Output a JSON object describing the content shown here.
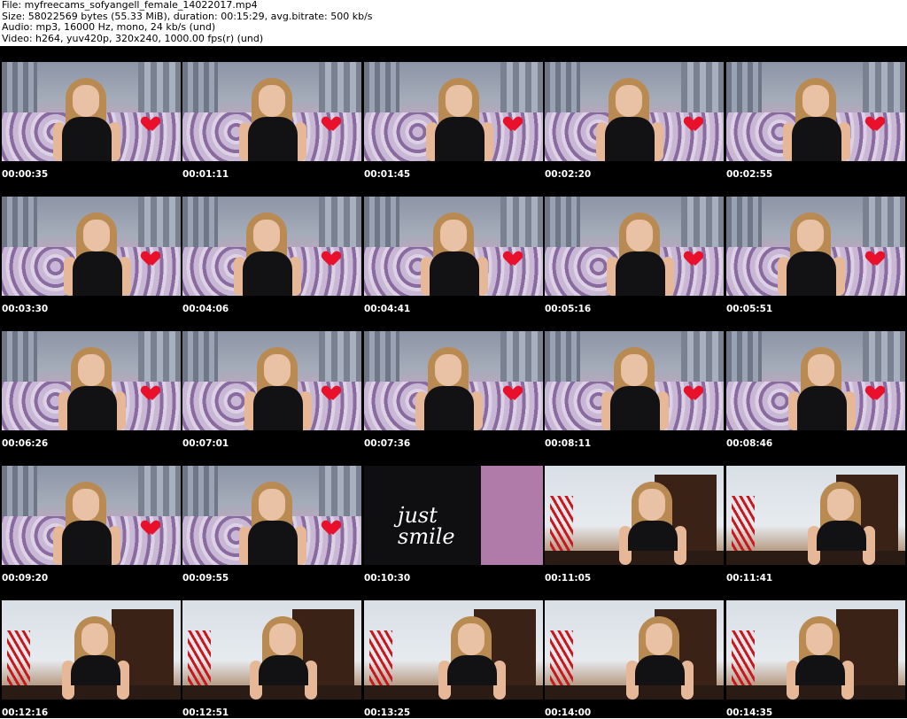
{
  "header": {
    "line1": "File: myfreecams_sofyangell_female_14022017.mp4",
    "line2": "Size: 58022569 bytes (55.33 MiB), duration: 00:15:29, avg.bitrate: 500 kb/s",
    "line3": "Audio: mp3, 16000 Hz, mono, 24 kb/s (und)",
    "line4": "Video: h264, yuv420p, 320x240, 1000.00 fps(r) (und)"
  },
  "thumbnails": [
    {
      "time": "00:00:35",
      "scene": "bedroom"
    },
    {
      "time": "00:01:11",
      "scene": "bedroom"
    },
    {
      "time": "00:01:45",
      "scene": "bedroom"
    },
    {
      "time": "00:02:20",
      "scene": "bedroom"
    },
    {
      "time": "00:02:55",
      "scene": "bedroom"
    },
    {
      "time": "00:03:30",
      "scene": "bedroom"
    },
    {
      "time": "00:04:06",
      "scene": "bedroom"
    },
    {
      "time": "00:04:41",
      "scene": "bedroom"
    },
    {
      "time": "00:05:16",
      "scene": "bedroom"
    },
    {
      "time": "00:05:51",
      "scene": "bedroom"
    },
    {
      "time": "00:06:26",
      "scene": "bedroom"
    },
    {
      "time": "00:07:01",
      "scene": "bedroom"
    },
    {
      "time": "00:07:36",
      "scene": "bedroom"
    },
    {
      "time": "00:08:11",
      "scene": "bedroom"
    },
    {
      "time": "00:08:46",
      "scene": "bedroom"
    },
    {
      "time": "00:09:20",
      "scene": "bedroom"
    },
    {
      "time": "00:09:55",
      "scene": "bedroom"
    },
    {
      "time": "00:10:30",
      "scene": "closeup",
      "shirt_text": [
        "just",
        "smile"
      ]
    },
    {
      "time": "00:11:05",
      "scene": "room2"
    },
    {
      "time": "00:11:41",
      "scene": "room2"
    },
    {
      "time": "00:12:16",
      "scene": "room2"
    },
    {
      "time": "00:12:51",
      "scene": "room2"
    },
    {
      "time": "00:13:25",
      "scene": "room2"
    },
    {
      "time": "00:14:00",
      "scene": "room2"
    },
    {
      "time": "00:14:35",
      "scene": "room2"
    }
  ]
}
